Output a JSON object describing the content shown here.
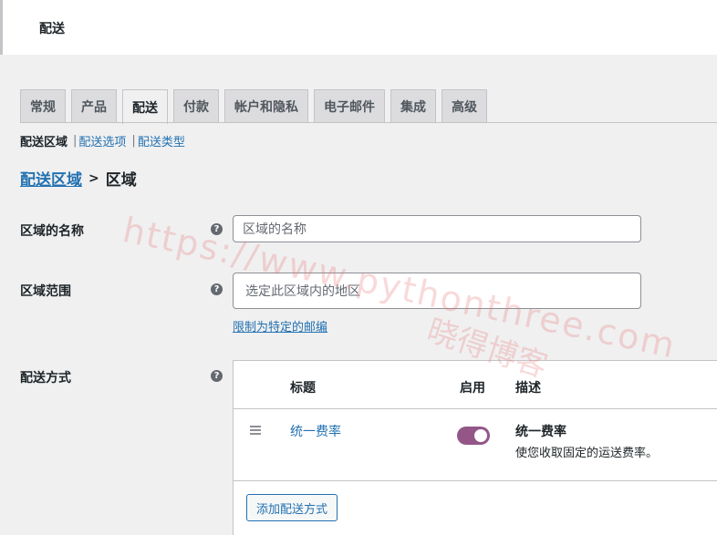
{
  "header": {
    "title": "配送"
  },
  "tabs": [
    {
      "label": "常规",
      "active": false
    },
    {
      "label": "产品",
      "active": false
    },
    {
      "label": "配送",
      "active": true
    },
    {
      "label": "付款",
      "active": false
    },
    {
      "label": "帐户和隐私",
      "active": false
    },
    {
      "label": "电子邮件",
      "active": false
    },
    {
      "label": "集成",
      "active": false
    },
    {
      "label": "高级",
      "active": false
    }
  ],
  "subnav": {
    "current": "配送区域",
    "separator": "|",
    "links": [
      "配送选项",
      "配送类型"
    ]
  },
  "breadcrumb": {
    "link": "配送区域",
    "separator": ">",
    "current": "区域"
  },
  "form": {
    "zone_name": {
      "label": "区域的名称",
      "placeholder": "区域的名称",
      "help": "?"
    },
    "zone_region": {
      "label": "区域范围",
      "placeholder": "选定此区域内的地区",
      "help": "?",
      "limit_link": "限制为特定的邮编"
    },
    "methods": {
      "label": "配送方式",
      "help": "?",
      "headers": {
        "title": "标题",
        "enabled": "启用",
        "description": "描述"
      },
      "rows": [
        {
          "name": "统一费率",
          "enabled": true,
          "desc_title": "统一费率",
          "desc_text": "使您收取固定的运送费率。"
        }
      ],
      "add_button": "添加配送方式"
    }
  },
  "watermark": {
    "line1": "https://www.pythonthree.com",
    "line2": "晓得博客"
  },
  "colors": {
    "accent": "#2271b1",
    "toggle_on": "#935687",
    "background": "#f0f0f1"
  }
}
